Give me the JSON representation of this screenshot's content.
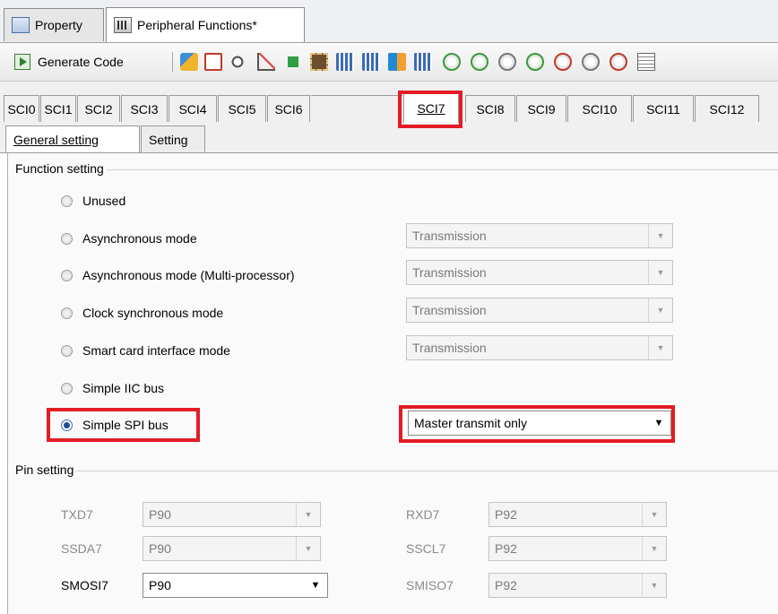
{
  "doc_tabs": [
    {
      "label": "Property",
      "icon": "property-icon"
    },
    {
      "label": "Peripheral Functions*",
      "icon": "peripheral-functions-icon"
    }
  ],
  "toolbar": {
    "generate_label": "Generate Code",
    "icons": [
      "module-icon",
      "clipboard-icon",
      "binoculars-icon",
      "chart-icon",
      "wizard-icon",
      "chip-icon",
      "component-icon",
      "component-icon",
      "transfer-icon",
      "bus-icon",
      "clock-icon",
      "clock-icon",
      "clock-icon",
      "clock-icon",
      "clock-icon",
      "clock-icon",
      "clock-icon",
      "grid-icon"
    ]
  },
  "sci_tabs": [
    "SCI0",
    "SCI1",
    "SCI2",
    "SCI3",
    "SCI4",
    "SCI5",
    "SCI6",
    "SCI7",
    "SCI8",
    "SCI9",
    "SCI10",
    "SCI11",
    "SCI12"
  ],
  "active_sci": "SCI7",
  "inner_tabs": [
    "General setting",
    "Setting"
  ],
  "function_setting": {
    "title": "Function setting",
    "options": [
      {
        "label": "Unused",
        "checked": false,
        "combo": null
      },
      {
        "label": "Asynchronous mode",
        "checked": false,
        "combo": "Transmission"
      },
      {
        "label": "Asynchronous mode (Multi-processor)",
        "checked": false,
        "combo": "Transmission"
      },
      {
        "label": "Clock synchronous mode",
        "checked": false,
        "combo": "Transmission"
      },
      {
        "label": "Smart card interface mode",
        "checked": false,
        "combo": "Transmission"
      },
      {
        "label": "Simple IIC bus",
        "checked": false,
        "combo": null
      },
      {
        "label": "Simple SPI bus",
        "checked": true,
        "combo": "Master transmit only"
      }
    ]
  },
  "pin_setting": {
    "title": "Pin setting",
    "rows": [
      [
        {
          "label": "TXD7",
          "value": "P90",
          "enabled": false
        },
        {
          "label": "RXD7",
          "value": "P92",
          "enabled": false
        }
      ],
      [
        {
          "label": "SSDA7",
          "value": "P90",
          "enabled": false
        },
        {
          "label": "SSCL7",
          "value": "P92",
          "enabled": false
        }
      ],
      [
        {
          "label": "SMOSI7",
          "value": "P90",
          "enabled": true
        },
        {
          "label": "SMISO7",
          "value": "P92",
          "enabled": false
        }
      ]
    ]
  },
  "colors": {
    "highlight": "#e31c25",
    "selected_radio": "#1d4f94"
  }
}
